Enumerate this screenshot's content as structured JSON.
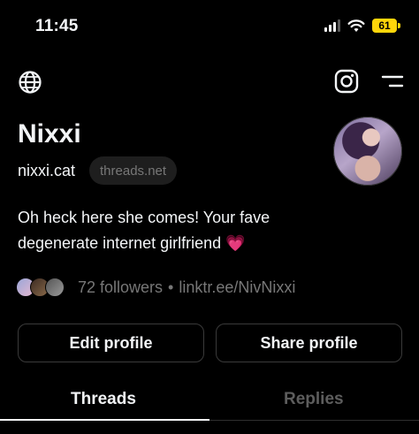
{
  "status_bar": {
    "time": "11:45",
    "battery": "61",
    "battery_color": "#ffd60a"
  },
  "top_bar": {
    "left_icon": "globe-icon",
    "right_icons": [
      "instagram-icon",
      "menu-icon"
    ]
  },
  "profile": {
    "name": "Nixxi",
    "username": "nixxi.cat",
    "domain_badge": "threads.net",
    "bio_line1": "Oh heck here she comes! Your fave",
    "bio_line2": "degenerate internet girlfriend 💗",
    "followers": "72 followers",
    "separator": "•",
    "link": "linktr.ee/NivNixxi"
  },
  "actions": {
    "edit_label": "Edit profile",
    "share_label": "Share profile"
  },
  "tabs": [
    {
      "label": "Threads",
      "active": true
    },
    {
      "label": "Replies",
      "active": false
    }
  ]
}
